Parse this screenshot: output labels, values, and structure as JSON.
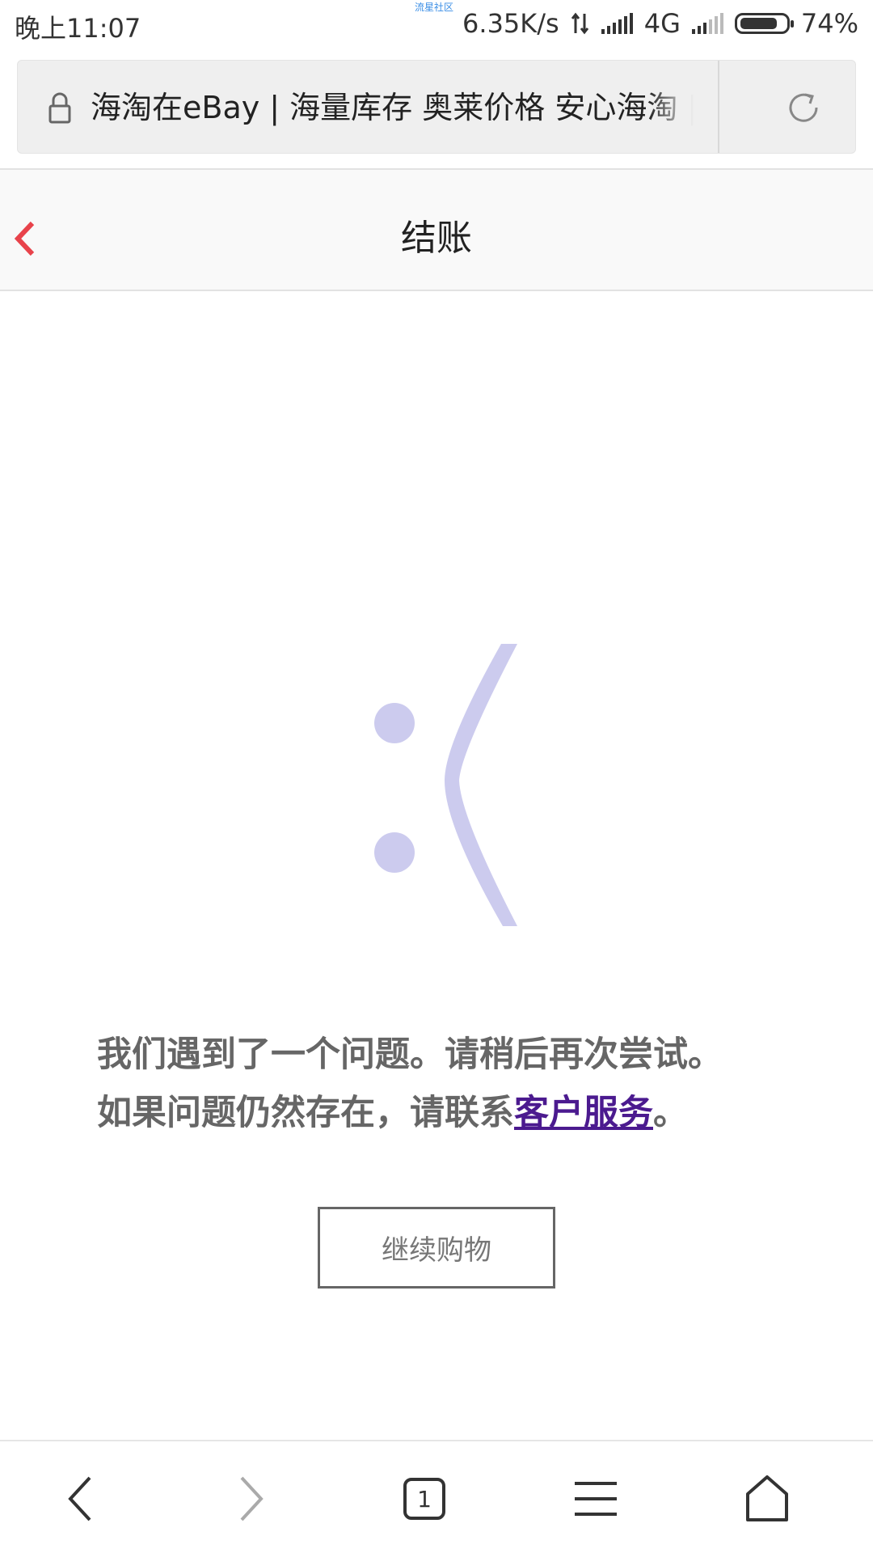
{
  "status_bar": {
    "time": "晚上11:07",
    "watermark": "流星社区",
    "speed": "6.35K/s",
    "network": "4G",
    "battery": "74%",
    "battery_level": 0.74
  },
  "url_bar": {
    "title": "海淘在eBay | 海量库存 奥莱价格 安心海淘 |"
  },
  "header": {
    "title": "结账"
  },
  "error": {
    "face": ":(",
    "face_color": "#cccbee",
    "line1": "我们遇到了一个问题。请稍后再次尝试。",
    "line2_prefix": "如果问题仍然存在，请联系",
    "link": "客户服务",
    "line2_suffix": "。",
    "link_color": "#4b1a8f"
  },
  "continue_button": {
    "label": "继续购物"
  },
  "bottom_nav": {
    "tab_count": "1"
  },
  "colors": {
    "accent_back": "#e8434b"
  }
}
